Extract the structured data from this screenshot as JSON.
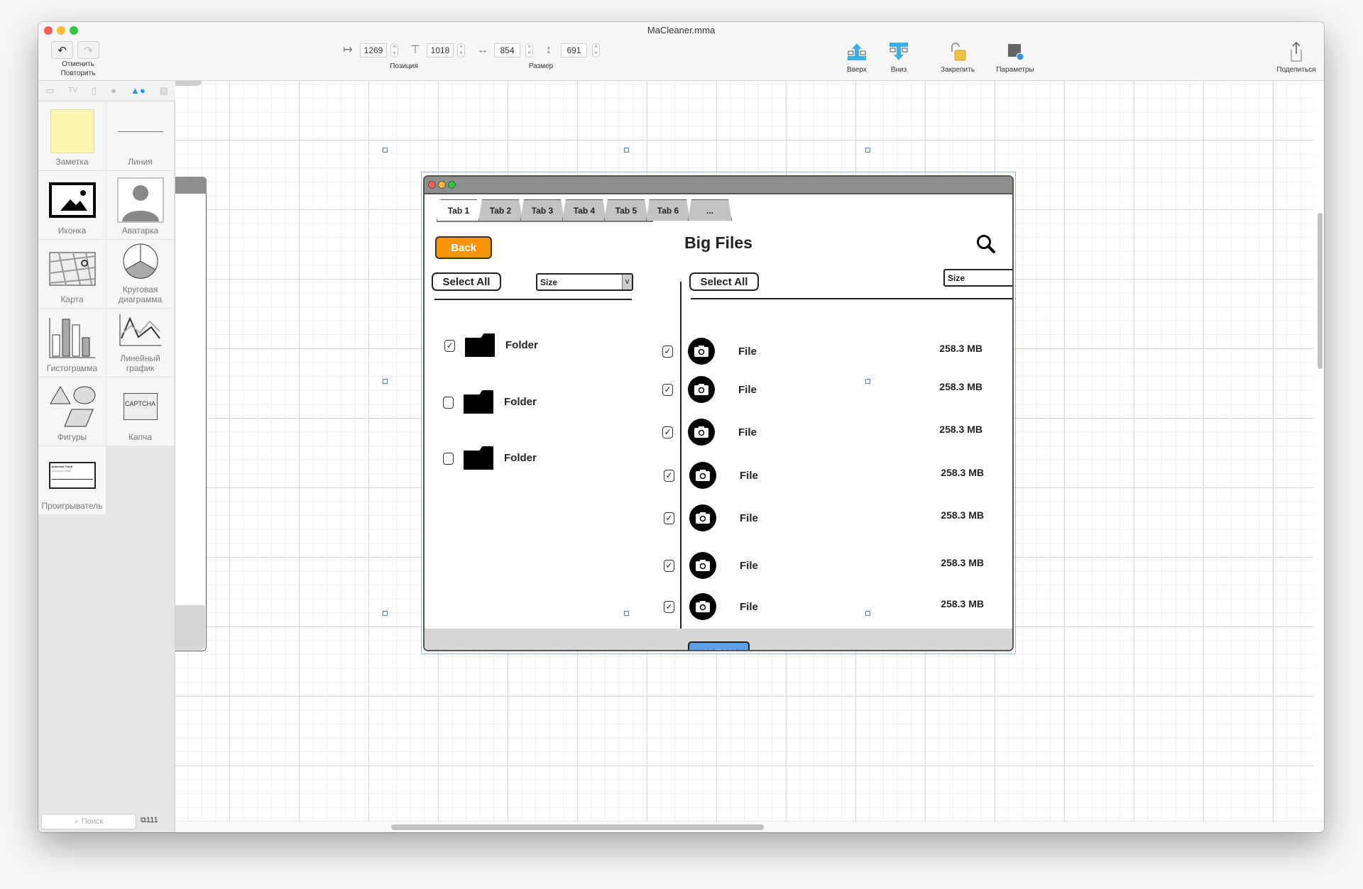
{
  "window": {
    "title": "MaCleaner.mma"
  },
  "toolbar": {
    "undo_label": "Отменить",
    "redo_label": "Повторить",
    "position": {
      "x": "1269",
      "y": "1018",
      "label": "Позиция"
    },
    "size": {
      "width": "854",
      "height": "691",
      "label": "Размер"
    },
    "actions": [
      {
        "label": "Вверх",
        "icon": "bring-forward-icon"
      },
      {
        "label": "Вниз",
        "icon": "send-backward-icon"
      },
      {
        "label": "Закрепить",
        "icon": "lock-open-icon"
      },
      {
        "label": "Параметры",
        "icon": "inspector-icon"
      }
    ],
    "share_label": "Поделиться"
  },
  "sidebar": {
    "palette_icons": [
      "desktop-icon",
      "tv-icon",
      "phone-icon",
      "android-icon",
      "shapes-icon",
      "image-icon"
    ],
    "items": [
      {
        "label": "Заметка"
      },
      {
        "label": "Линия"
      },
      {
        "label": "Иконка"
      },
      {
        "label": "Аватарка"
      },
      {
        "label": "Карта"
      },
      {
        "label": "Круговая диаграмма"
      },
      {
        "label": "Гистограмма"
      },
      {
        "label": "Линейный график"
      },
      {
        "label": "Фигуры"
      },
      {
        "label": "Капча"
      },
      {
        "label": "Проигрыватель"
      }
    ],
    "player_thumb": {
      "track": "Unknown Track",
      "artist": "Unknown Artist"
    },
    "captcha_text": "CAPTCHA",
    "search_placeholder": "Поиск",
    "count": "111"
  },
  "mockup": {
    "tabs": [
      "Tab 1",
      "Tab 2",
      "Tab 3",
      "Tab 4",
      "Tab 5",
      "Tab 6",
      "..."
    ],
    "active_tab": 0,
    "back_label": "Back",
    "title": "Big Files",
    "left": {
      "select_all": "Select All",
      "sort": "Size",
      "folders": [
        {
          "name": "Folder",
          "checked": true
        },
        {
          "name": "Folder",
          "checked": false
        },
        {
          "name": "Folder",
          "checked": false
        }
      ]
    },
    "right": {
      "select_all": "Select All",
      "sort": "Size",
      "files": [
        {
          "name": "File",
          "size": "258.3 MB",
          "checked": true
        },
        {
          "name": "File",
          "size": "258.3 MB",
          "checked": true
        },
        {
          "name": "File",
          "size": "258.3 MB",
          "checked": true
        },
        {
          "name": "File",
          "size": "258.3 MB",
          "checked": true
        },
        {
          "name": "File",
          "size": "258.3 MB",
          "checked": true
        },
        {
          "name": "File",
          "size": "258.3 MB",
          "checked": true
        },
        {
          "name": "File",
          "size": "258.3 MB",
          "checked": true
        }
      ]
    },
    "clean_label": "CLEAN",
    "colors": {
      "back": "#f89406",
      "clean": "#5aa0e8",
      "titlebar": "#8e8e8e"
    }
  }
}
